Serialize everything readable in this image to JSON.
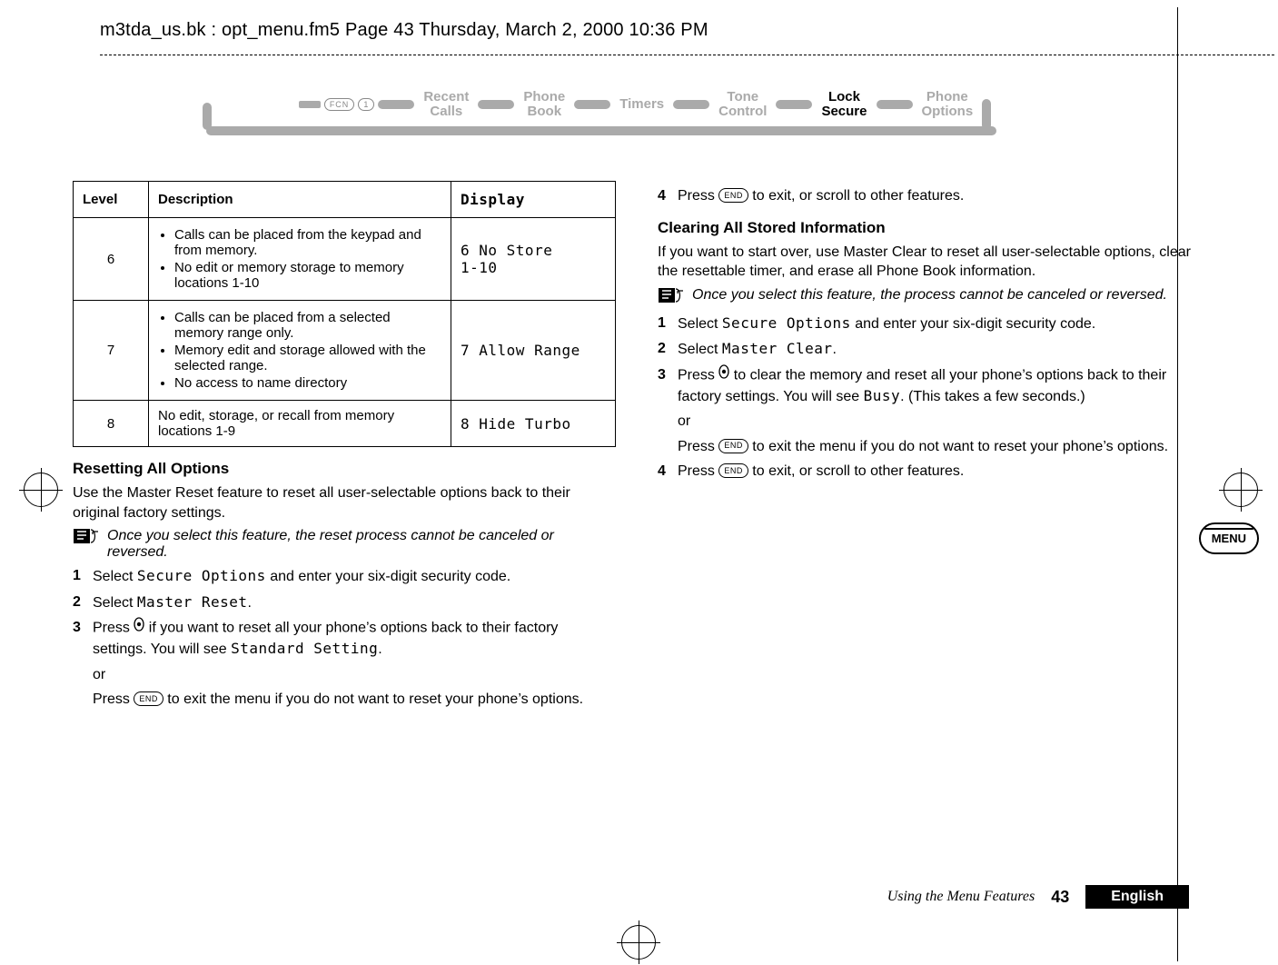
{
  "print_header": "m3tda_us.bk : opt_menu.fm5  Page 43  Thursday, March 2, 2000  10:36 PM",
  "nav": {
    "start_keys": [
      "FCN",
      "1"
    ],
    "items": [
      {
        "line1": "Recent",
        "line2": "Calls",
        "active": false
      },
      {
        "line1": "Phone",
        "line2": "Book",
        "active": false
      },
      {
        "line1": "Timers",
        "line2": "",
        "active": false
      },
      {
        "line1": "Tone",
        "line2": "Control",
        "active": false
      },
      {
        "line1": "Lock",
        "line2": "Secure",
        "active": true
      },
      {
        "line1": "Phone",
        "line2": "Options",
        "active": false
      }
    ]
  },
  "table": {
    "head": {
      "level": "Level",
      "desc": "Description",
      "disp": "Display"
    },
    "rows": [
      {
        "level": "6",
        "bullets": [
          "Calls can be placed from the keypad and from memory.",
          "No edit or memory storage to memory locations 1-10"
        ],
        "display_l1": "6 No Store",
        "display_l2": "1-10"
      },
      {
        "level": "7",
        "bullets": [
          "Calls can be placed from a selected memory range only.",
          "Memory edit and storage allowed with the selected range.",
          "No access to name directory"
        ],
        "display_l1": "7 Allow Range",
        "display_l2": ""
      },
      {
        "level": "8",
        "plain": "No edit, storage, or recall from memory locations 1-9",
        "display_l1": "8 Hide Turbo",
        "display_l2": ""
      }
    ]
  },
  "left": {
    "heading": "Resetting All Options",
    "para": "Use the Master Reset feature to reset all user-selectable options back to their original factory settings.",
    "note": "Once you select this feature, the reset process cannot be canceled or reversed.",
    "steps": {
      "s1a": "Select ",
      "s1m": "Secure Options",
      "s1b": " and enter your six-digit security code.",
      "s2a": "Select ",
      "s2m": "Master Reset",
      "s2b": ".",
      "s3a": "Press ",
      "s3b": " if you want to reset all your phone’s options back to their factory settings. You will see ",
      "s3m": "Standard Setting",
      "s3c": ".",
      "or": "or",
      "s3alt_a": "Press ",
      "s3alt_key": "END",
      "s3alt_b": " to exit the menu if you do not want to reset your phone’s options.",
      "s4a": "Press ",
      "s4key": "END",
      "s4b": " to exit, or scroll to other features."
    }
  },
  "right": {
    "heading": "Clearing All Stored Information",
    "s4a": "Press ",
    "s4key": "END",
    "s4b": " to exit, or scroll to other features.",
    "para": "If you want to start over, use Master Clear to reset all user-selectable options, clear the resettable timer, and erase all Phone Book information.",
    "note": "Once you select this feature, the process cannot be canceled or reversed.",
    "steps": {
      "s1a": "Select ",
      "s1m": "Secure Options",
      "s1b": " and enter your six-digit security code.",
      "s2a": "Select ",
      "s2m": "Master Clear",
      "s2b": ".",
      "s3a": "Press ",
      "s3b": " to clear the memory and reset all your phone’s options back to their factory settings. You will see ",
      "s3m": "Busy",
      "s3c": ". (This takes a few seconds.)",
      "or": "or",
      "s3alt_a": "Press ",
      "s3alt_key": "END",
      "s3alt_b": " to exit the menu if you do not want to reset your phone’s options.",
      "r4a": "Press ",
      "r4key": "END",
      "r4b": " to exit, or scroll to other features."
    }
  },
  "menu_badge": "MENU",
  "footer": {
    "title": "Using the Menu Features",
    "page": "43",
    "lang": "English"
  }
}
